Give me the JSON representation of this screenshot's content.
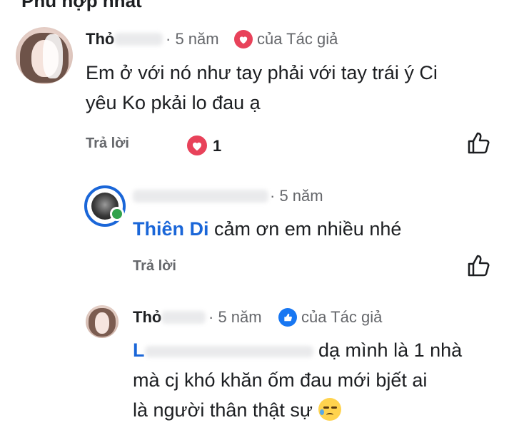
{
  "section_header": "Phù hợp nhất",
  "comments": [
    {
      "author": "Thỏ",
      "time": "5 năm",
      "author_badge": "của Tác giả",
      "text_line1": "Em ở với nó như tay phải với tay trái ý Ci",
      "text_line2": "yêu Ko pkải lo đau ạ",
      "reply_label": "Trả lời",
      "reaction_count": "1"
    },
    {
      "time": "5 năm",
      "mention": "Thiên Di",
      "text": "cảm ơn em nhiều nhé",
      "reply_label": "Trả lời"
    },
    {
      "author": "Thỏ",
      "time": "5 năm",
      "author_badge": "của Tác giả",
      "mention_initial": "L",
      "text_line1": "dạ mình là 1 nhà",
      "text_line2": "mà cj khó khăn ốm đau mới bjết ai",
      "text_line3": "là người thân thật sự"
    }
  ],
  "icons": {
    "like": "thumbs-up-outline-icon",
    "heart": "heart-reaction-icon",
    "author_like": "like-badge-icon",
    "emoji": "sleepy-face-emoji"
  },
  "colors": {
    "mention": "#1a66d8",
    "heart": "#e8425a",
    "like_blue": "#1877f2",
    "meta_gray": "#65676b"
  }
}
